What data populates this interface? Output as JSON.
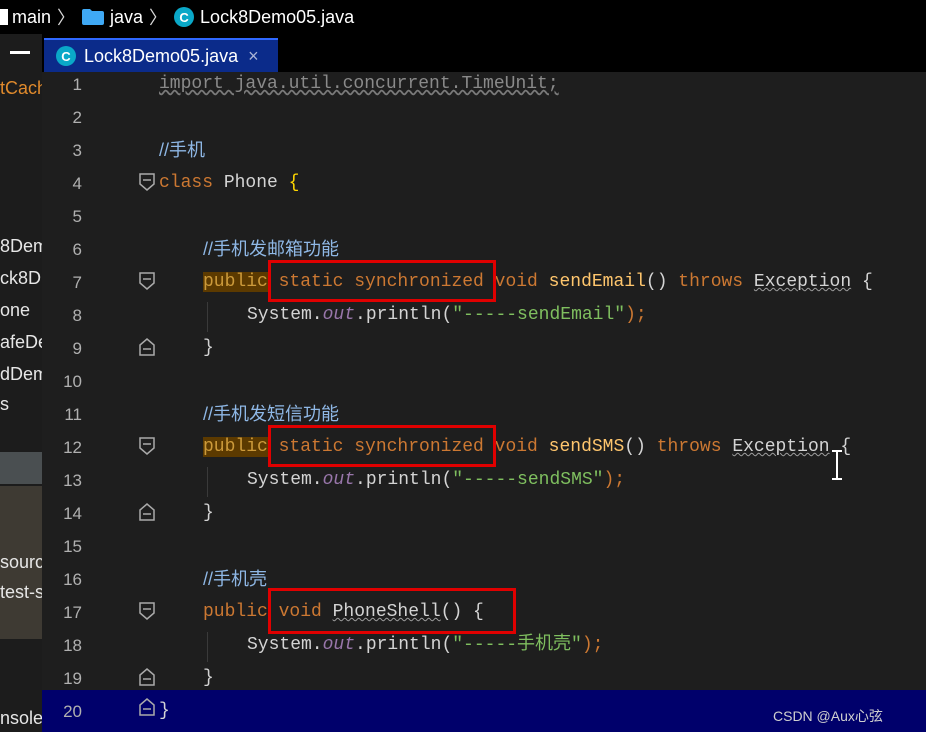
{
  "breadcrumb": {
    "items": [
      "main",
      "java",
      "Lock8Demo05.java"
    ],
    "icons": [
      "folder-icon",
      "class-icon"
    ]
  },
  "left_panel": {
    "items": [
      "tCach",
      "8Dem",
      "ck8D",
      "one",
      "afeDe",
      "dDem",
      "s",
      "sourc",
      "test-s",
      "nsoles"
    ]
  },
  "tab": {
    "label": "Lock8Demo05.java",
    "close": "×"
  },
  "editor": {
    "line_numbers": [
      "1",
      "2",
      "3",
      "4",
      "5",
      "6",
      "7",
      "8",
      "9",
      "10",
      "11",
      "12",
      "13",
      "14",
      "15",
      "16",
      "17",
      "18",
      "19",
      "20"
    ],
    "lines": {
      "l1": "import java.util.concurrent.TimeUnit;",
      "l3": "//手机",
      "l4_kw": "class",
      "l4_name": " Phone ",
      "l4_brace": "{",
      "l6": "//手机发邮箱功能",
      "l7_pub": "public",
      "l7_mod": " static synchronized ",
      "l7_void": "void ",
      "l7_fn": "sendEmail",
      "l7_rest1": "() ",
      "l7_throws": "throws ",
      "l7_exc": "Exception",
      "l7_rest2": " {",
      "l8_sys": "System.",
      "l8_out": "out",
      "l8_print": ".println(",
      "l8_str": "\"-----sendEmail\"",
      "l8_end": ");",
      "l9": "}",
      "l11": "//手机发短信功能",
      "l12_pub": "public",
      "l12_mod": " static synchronized ",
      "l12_void": "void ",
      "l12_fn": "sendSMS",
      "l12_rest1": "() ",
      "l12_throws": "throws ",
      "l12_exc": "Exception",
      "l12_rest2": " {",
      "l13_sys": "System.",
      "l13_out": "out",
      "l13_print": ".println(",
      "l13_str": "\"-----sendSMS\"",
      "l13_end": ");",
      "l14": "}",
      "l16": "//手机壳",
      "l17_pub": "public",
      "l17_void": " void ",
      "l17_fn": "PhoneShell",
      "l17_rest": "() {",
      "l18_sys": "System.",
      "l18_out": "out",
      "l18_print": ".println(",
      "l18_str": "\"-----手机壳\"",
      "l18_end": ");",
      "l19": "}",
      "l20": "}"
    }
  },
  "watermark": "CSDN @Aux心弦",
  "colors": {
    "highlight_box": "#e00000",
    "keyword": "#cc7832",
    "method": "#ffc66d",
    "string": "#6a8759",
    "comment": "#8fb8e6",
    "static_field": "#9876aa",
    "tab_active": "#0b2b8a"
  }
}
